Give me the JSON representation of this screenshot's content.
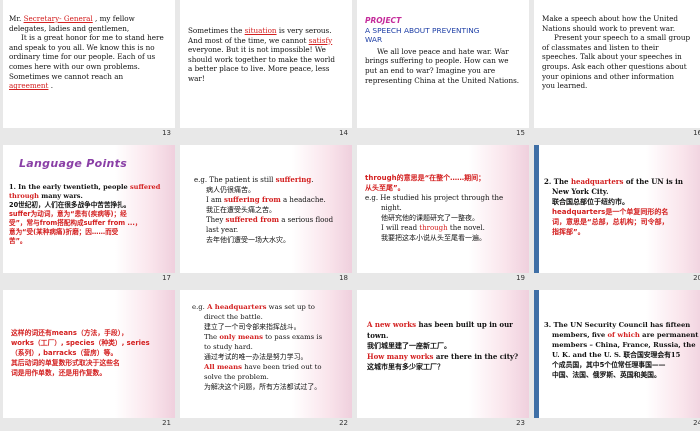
{
  "slides": [
    {
      "num": "13",
      "lines": {
        "l1a": "Mr. ",
        "l1b": "Secretary- General",
        "l1c": " , my fellow",
        "l2": "delegates, ladies and gentlemen,",
        "l3": "It is a great honor for me to stand here",
        "l4": "and speak to you all. We know this is no",
        "l5": "ordinary time for our people. Each of us",
        "l6": "comes here with our own problems.",
        "l7": "Sometimes we cannot reach an",
        "l8a": "agreement",
        "l8b": " ."
      }
    },
    {
      "num": "14",
      "lines": {
        "l1a": "Sometimes the ",
        "l1b": "situation",
        "l1c": " is very serous.",
        "l2a": "And most of the time, we cannot ",
        "l2b": "satisfy",
        "l3": "everyone. But it is not impossible! We",
        "l4": "should work together to make the world",
        "l5": "a better place to live. More peace, less",
        "l6": "war!"
      }
    },
    {
      "num": "15",
      "lines": {
        "project": "PROJECT",
        "t1": "A SPEECH ABOUT PREVENTING",
        "t2": "WAR",
        "l1": "We all love peace and hate war. War",
        "l2": "brings suffering to people. How can we",
        "l3": "put an end to war? Imagine you are",
        "l4": "representing China at the United Nations."
      }
    },
    {
      "num": "16",
      "lines": {
        "l1": "Make a speech about how the United",
        "l2": "Nations should work to prevent war.",
        "l3": "Present your speech to a small group",
        "l4": "of classmates and listen to their",
        "l5": "speeches. Talk about your speeches in",
        "l6": "groups. Ask each other questions about",
        "l7": "your opinions and other information",
        "l8": "you learned."
      }
    },
    {
      "num": "17",
      "lines": {
        "title": "Language Points",
        "l1a": "1. In the early twentieth, people ",
        "l1b": "suffered",
        "l2a": "through",
        "l2b": " many wars.",
        "l3": "20世纪初，人们在很多战争中苦苦挣扎。",
        "l4": "suffer为动词，意为“患有(疾病等)；经",
        "l5": "受”，常与from搭配构成suffer from ...，",
        "l6": "意为“受(某种病痛)折磨；因……而受",
        "l7": "苦”。"
      }
    },
    {
      "num": "18",
      "lines": {
        "l1a": "e.g. The patient is still ",
        "l1b": "suffering",
        "l1c": ".",
        "l2": "病人仍很痛苦。",
        "l3a": "I am ",
        "l3b": "suffering from",
        "l3c": " a headache.",
        "l4": "我正在遭受头痛之苦。",
        "l5a": "They ",
        "l5b": "suffered from",
        "l5c": " a serious flood",
        "l6": "last year.",
        "l7": "去年他们遭受一场大水灾。"
      }
    },
    {
      "num": "19",
      "lines": {
        "l1a": "through",
        "l1b": "的意思是“在整个……期间；",
        "l2": "从头至尾”。",
        "l3": "e.g. He studied his project through the",
        "l4": "night.",
        "l5": "他研究他的课题研究了一整夜。",
        "l6a": "I will read ",
        "l6b": "through",
        "l6c": " the novel.",
        "l7": "我要把这本小说从头至尾看一遍。"
      }
    },
    {
      "num": "20",
      "lines": {
        "l1a": "2. The ",
        "l1b": "headquarters",
        "l1c": " of the UN is in",
        "l2": "New York City.",
        "l3": "联合国总部位于纽约市。",
        "l4a": "headquarters",
        "l4b": "是一个单复同形的名",
        "l5": "词，意思是“总部，总机构；司令部，",
        "l6": "指挥部”。"
      }
    },
    {
      "num": "21",
      "lines": {
        "l1": "这样的词还有means（方法，手段），",
        "l2": "works（工厂）, species（种类）, series",
        "l3": "（系列）, barracks（营房）等。",
        "l4": "其后动词的单复数形式取决于这些名",
        "l5": "词是用作单数，还是用作复数。"
      }
    },
    {
      "num": "22",
      "lines": {
        "l1a": "e.g. ",
        "l1b": "A headquarters",
        "l1c": " was set up to",
        "l2": "direct the battle.",
        "l3": "建立了一个司令部来指挥战斗。",
        "l4a": "The ",
        "l4b": "only means",
        "l4c": " to pass exams is",
        "l5": "to study hard.",
        "l6": "通过考试的唯一办法是努力学习。",
        "l7a": "All means",
        "l7b": " have been tried out to",
        "l8": "solve the problem.",
        "l9": "为解决这个问题，所有方法都试过了。"
      }
    },
    {
      "num": "23",
      "lines": {
        "l1a": "A new works",
        "l1b": " has been built up in our",
        "l2": "town.",
        "l3": "我们城里建了一座新工厂。",
        "l4a": "How many works",
        "l4b": " are there in the city?",
        "l5": "这城市里有多少家工厂？"
      }
    },
    {
      "num": "24",
      "lines": {
        "l1": "3. The UN Security Council has fifteen",
        "l2a": "members, five ",
        "l2b": "of which",
        "l2c": " are permanent",
        "l3": "members – China, France, Russia, the",
        "l4": "U. K. and the U. S.   联合国安理会有15",
        "l5": "个成员国，其中5个位常任理事国——",
        "l6": "中国、法国、俄罗斯、英国和美国。"
      }
    }
  ]
}
